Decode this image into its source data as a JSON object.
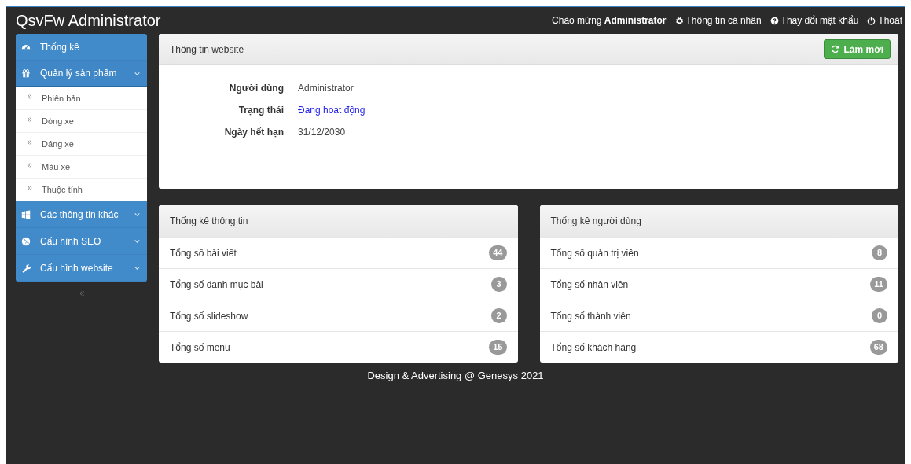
{
  "header": {
    "title": "QsvFw Administrator",
    "welcome": "Chào mừng",
    "user": "Administrator",
    "links": [
      {
        "label": "Thông tin cá nhân"
      },
      {
        "label": "Thay đổi mật khẩu"
      },
      {
        "label": "Thoát"
      }
    ]
  },
  "sidebar": {
    "items": [
      {
        "label": "Thống kê",
        "kind": "link",
        "selected": false
      },
      {
        "label": "Quản lý sản phẩm",
        "kind": "group",
        "expanded": true,
        "children": [
          {
            "label": "Phiên bản"
          },
          {
            "label": "Dòng xe"
          },
          {
            "label": "Dáng xe"
          },
          {
            "label": "Màu xe"
          },
          {
            "label": "Thuộc tính"
          }
        ]
      },
      {
        "label": "Các thông tin khác",
        "kind": "group",
        "expanded": false
      },
      {
        "label": "Cấu hình SEO",
        "kind": "group",
        "expanded": false
      },
      {
        "label": "Cấu hình website",
        "kind": "group",
        "expanded": false
      }
    ]
  },
  "info_panel": {
    "title": "Thông tin website",
    "button": "Làm mới",
    "fields": [
      {
        "label": "Người dùng",
        "value": "Administrator",
        "kind": "text"
      },
      {
        "label": "Trạng thái",
        "value": "Đang hoạt động",
        "kind": "link"
      },
      {
        "label": "Ngày hết hạn",
        "value": "31/12/2030",
        "kind": "text"
      }
    ]
  },
  "stat_panels": [
    {
      "title": "Thống kê thông tin",
      "rows": [
        {
          "label": "Tổng số bài viết",
          "count": "44"
        },
        {
          "label": "Tổng số danh mục bài",
          "count": "3"
        },
        {
          "label": "Tổng số slideshow",
          "count": "2"
        },
        {
          "label": "Tổng số menu",
          "count": "15"
        }
      ]
    },
    {
      "title": "Thống kê người dùng",
      "rows": [
        {
          "label": "Tổng số quản trị viên",
          "count": "8"
        },
        {
          "label": "Tổng số nhân viên",
          "count": "11"
        },
        {
          "label": "Tổng số thành viên",
          "count": "0"
        },
        {
          "label": "Tổng số khách hàng",
          "count": "68"
        }
      ]
    }
  ],
  "footer": "Design & Advertising @ Genesys 2021"
}
